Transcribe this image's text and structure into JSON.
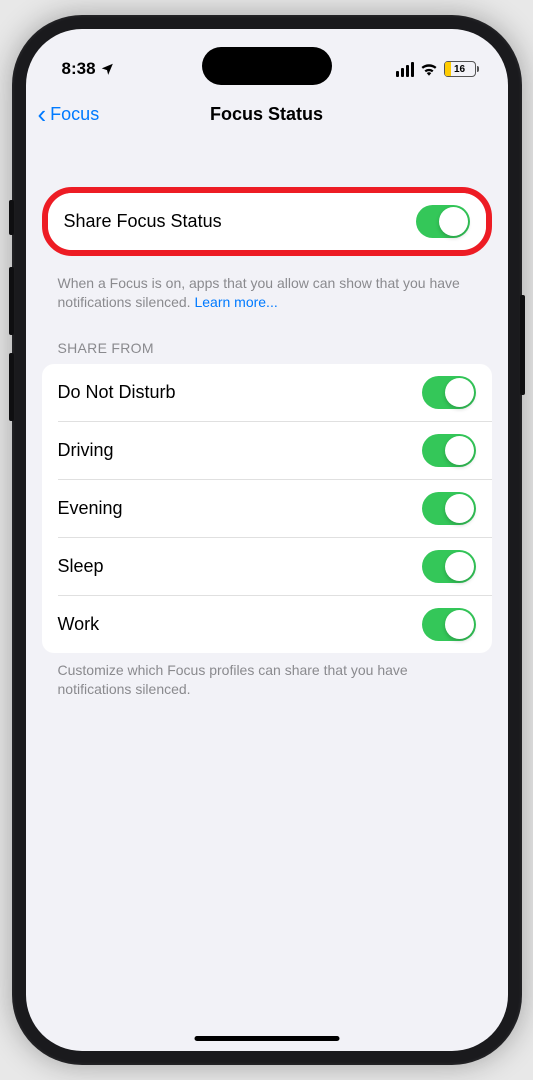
{
  "status": {
    "time": "8:38",
    "battery_percent": "16"
  },
  "nav": {
    "back_label": "Focus",
    "title": "Focus Status"
  },
  "main_toggle": {
    "label": "Share Focus Status",
    "on": true,
    "footer": "When a Focus is on, apps that you allow can show that you have notifications silenced. ",
    "learn_more": "Learn more..."
  },
  "share_from": {
    "header": "SHARE FROM",
    "items": [
      {
        "label": "Do Not Disturb",
        "on": true
      },
      {
        "label": "Driving",
        "on": true
      },
      {
        "label": "Evening",
        "on": true
      },
      {
        "label": "Sleep",
        "on": true
      },
      {
        "label": "Work",
        "on": true
      }
    ],
    "footer": "Customize which Focus profiles can share that you have notifications silenced."
  },
  "annotation": {
    "highlight_color": "#ed1c24"
  }
}
